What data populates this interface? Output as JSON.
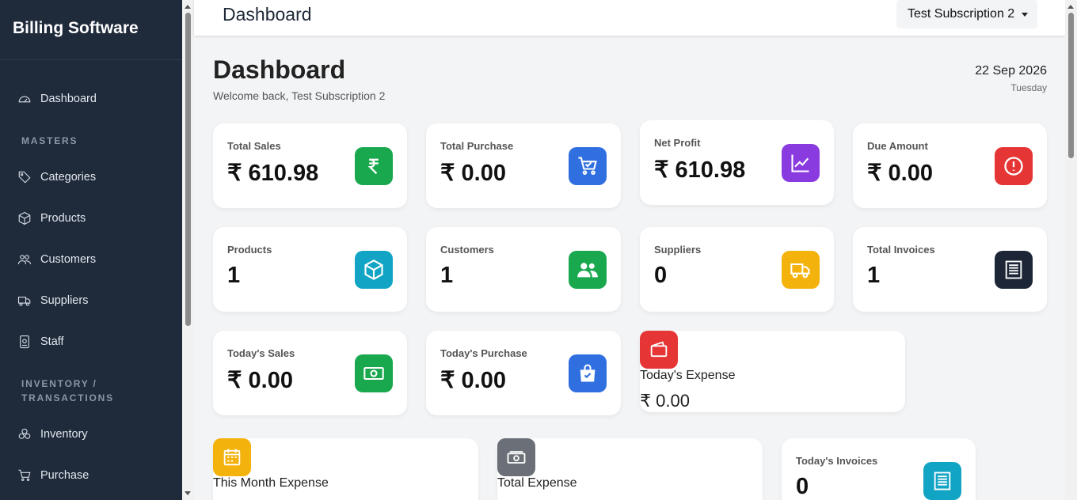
{
  "app": {
    "brand": "Billing Software"
  },
  "topbar": {
    "title": "Dashboard",
    "subscription": "Test Subscription 2"
  },
  "sidebar": {
    "items": [
      {
        "label": "Dashboard",
        "icon": "gauge-icon"
      },
      {
        "label": "Categories",
        "icon": "tag-icon"
      },
      {
        "label": "Products",
        "icon": "box-icon"
      },
      {
        "label": "Customers",
        "icon": "people-icon"
      },
      {
        "label": "Suppliers",
        "icon": "truck-icon"
      },
      {
        "label": "Staff",
        "icon": "badge-icon"
      },
      {
        "label": "Inventory",
        "icon": "boxes-icon"
      },
      {
        "label": "Purchase",
        "icon": "cart-icon"
      }
    ],
    "sections": {
      "masters": "MASTERS",
      "inventory_line1": "INVENTORY /",
      "inventory_line2": "TRANSACTIONS"
    }
  },
  "header": {
    "title": "Dashboard",
    "welcome": "Welcome back, Test Subscription 2",
    "date": "22 Sep 2026",
    "day": "Tuesday"
  },
  "stats": {
    "total_sales": {
      "label": "Total Sales",
      "value": "₹ 610.98",
      "color": "#1aa84f"
    },
    "total_purchase": {
      "label": "Total Purchase",
      "value": "₹ 0.00",
      "color": "#2f6fe0"
    },
    "net_profit": {
      "label": "Net Profit",
      "value": "₹ 610.98",
      "color": "#8a3be0"
    },
    "due_amount": {
      "label": "Due Amount",
      "value": "₹ 0.00",
      "color": "#e53535"
    },
    "products": {
      "label": "Products",
      "value": "1",
      "color": "#12a4c4"
    },
    "customers": {
      "label": "Customers",
      "value": "1",
      "color": "#1aa84f"
    },
    "suppliers": {
      "label": "Suppliers",
      "value": "0",
      "color": "#f4b20d"
    },
    "total_invoices": {
      "label": "Total Invoices",
      "value": "1",
      "color": "#1d2636"
    },
    "todays_sales": {
      "label": "Today's Sales",
      "value": "₹ 0.00",
      "color": "#1aa84f"
    },
    "todays_purchase": {
      "label": "Today's Purchase",
      "value": "₹ 0.00",
      "color": "#2f6fe0"
    },
    "todays_expense": {
      "label": "Today's Expense",
      "value": "₹ 0.00",
      "color": "#e53535"
    },
    "month_expense": {
      "label": "This Month Expense",
      "color": "#f4b20d"
    },
    "total_expense": {
      "label": "Total Expense",
      "color": "#6b7078"
    },
    "todays_invoices": {
      "label": "Today's Invoices",
      "value": "0",
      "color": "#12a4c4"
    }
  }
}
